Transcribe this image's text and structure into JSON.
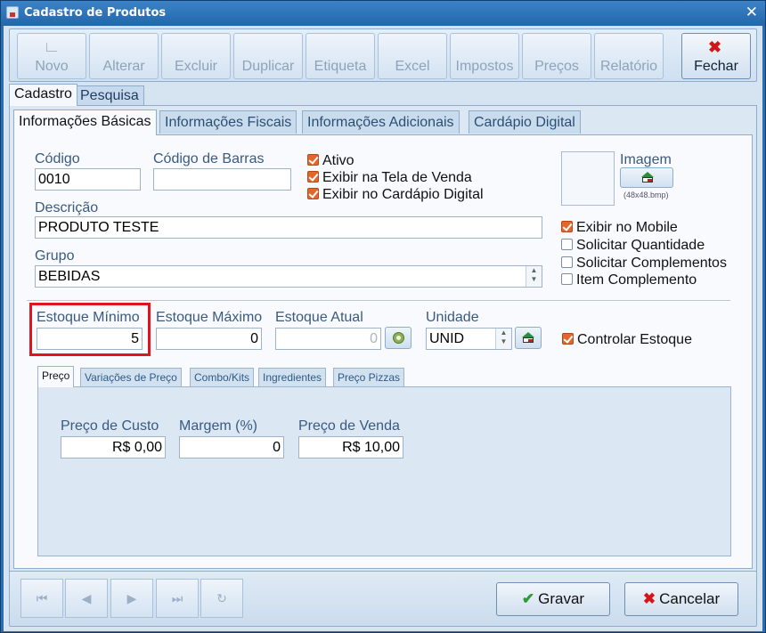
{
  "window": {
    "title": "Cadastro de Produtos",
    "close_glyph": "✕"
  },
  "toolbar": {
    "novo": "Novo",
    "alterar": "Alterar",
    "excluir": "Excluir",
    "duplicar": "Duplicar",
    "etiqueta": "Etiqueta",
    "excel": "Excel",
    "impostos": "Impostos",
    "precos": "Preços",
    "relatorio": "Relatório",
    "fechar": "Fechar",
    "fechar_icon": "close-x-icon"
  },
  "outer_tabs": {
    "cadastro": "Cadastro",
    "pesquisa": "Pesquisa",
    "selected": "Cadastro"
  },
  "inner_tabs": {
    "basicas": "Informações Básicas",
    "fiscais": "Informações Fiscais",
    "adicionais": "Informações Adicionais",
    "cardapio": "Cardápio Digital",
    "selected": "Informações Básicas"
  },
  "form": {
    "codigo_label": "Código",
    "codigo_value": "0010",
    "barras_label": "Código de Barras",
    "barras_value": "",
    "descricao_label": "Descrição",
    "descricao_value": "PRODUTO TESTE",
    "grupo_label": "Grupo",
    "grupo_value": "BEBIDAS",
    "ativo": {
      "label": "Ativo",
      "checked": true
    },
    "tela_venda": {
      "label": "Exibir na Tela de Venda",
      "checked": true
    },
    "cardapio_digital": {
      "label": "Exibir no Cardápio Digital",
      "checked": true
    },
    "imagem_label": "Imagem",
    "imagem_size": "(48x48.bmp)",
    "mobile": {
      "label": "Exibir no Mobile",
      "checked": true
    },
    "solicitar_qtd": {
      "label": "Solicitar Quantidade",
      "checked": false
    },
    "solicitar_comp": {
      "label": "Solicitar Complementos",
      "checked": false
    },
    "item_comp": {
      "label": "Item Complemento",
      "checked": false
    },
    "estoque_min_label": "Estoque Mínimo",
    "estoque_min_value": "5",
    "estoque_max_label": "Estoque Máximo",
    "estoque_max_value": "0",
    "estoque_atual_label": "Estoque Atual",
    "estoque_atual_value": "0",
    "unidade_label": "Unidade",
    "unidade_value": "UNID",
    "controlar": {
      "label": "Controlar Estoque",
      "checked": true
    }
  },
  "price_tabs": {
    "preco": "Preço",
    "variacoes": "Variações de Preço",
    "combo": "Combo/Kits",
    "ingredientes": "Ingredientes",
    "pizzas": "Preço Pizzas",
    "selected": "Preço"
  },
  "price": {
    "custo_label": "Preço de Custo",
    "custo_value": "R$ 0,00",
    "margem_label": "Margem (%)",
    "margem_value": "0",
    "venda_label": "Preço de Venda",
    "venda_value": "R$ 10,00"
  },
  "footer": {
    "first": "⏮",
    "prev": "◀",
    "next": "▶",
    "last": "⏭",
    "refresh": "↻",
    "gravar": "Gravar",
    "cancelar": "Cancelar"
  },
  "colors": {
    "title_bar": "#2a6eb0",
    "highlight": "#e0141e",
    "checkbox_on": "#e2672d"
  }
}
